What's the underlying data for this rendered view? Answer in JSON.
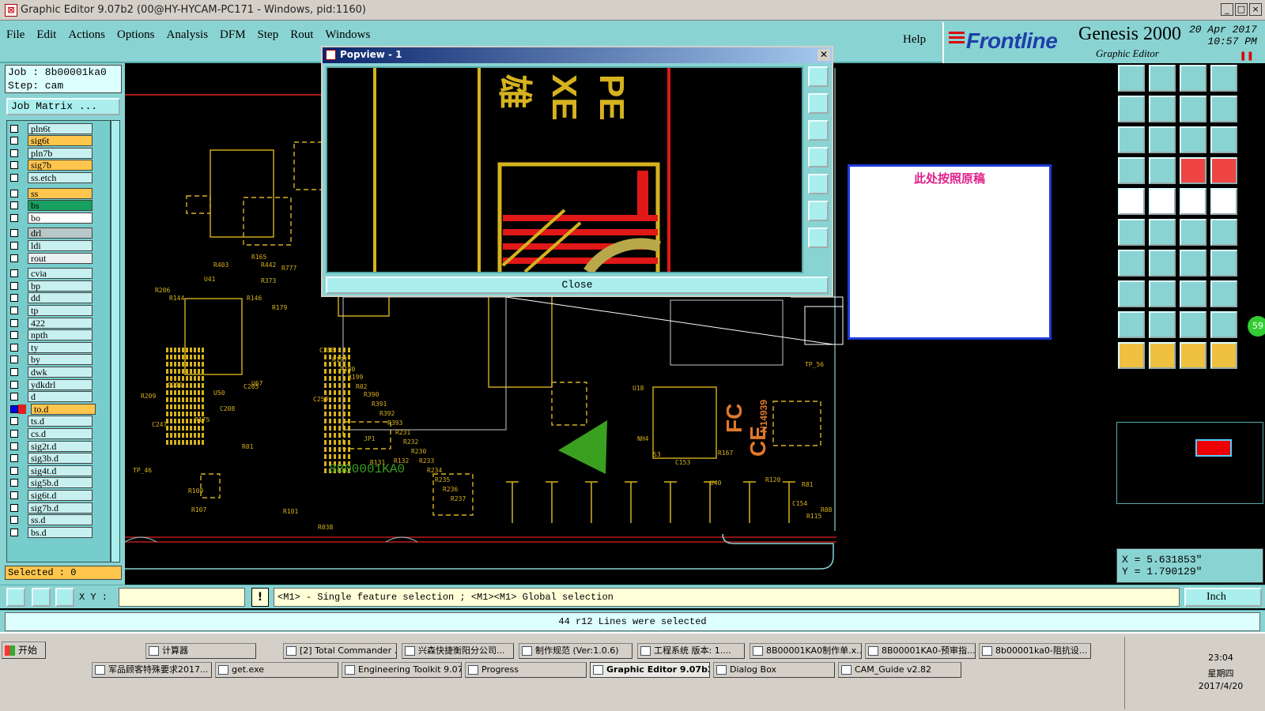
{
  "window": {
    "title": "Graphic Editor 9.07b2 (00@HY-HYCAM-PC171 - Windows, pid:1160)",
    "buttons": [
      "_",
      "□",
      "×"
    ]
  },
  "menu": {
    "items": [
      "File",
      "Edit",
      "Actions",
      "Options",
      "Analysis",
      "DFM",
      "Step",
      "Rout",
      "Windows"
    ],
    "help": "Help"
  },
  "brand": {
    "frontline": "Frontline",
    "genesis": "Genesis 2000",
    "subtitle": "Graphic Editor",
    "date": "20 Apr 2017",
    "time": "10:57 PM"
  },
  "job": {
    "name": "Job : 8b00001ka0",
    "step": "Step: cam",
    "matrix_button": "Job Matrix ..."
  },
  "layers": [
    {
      "name": "pln6t",
      "color": "#c8f0f0"
    },
    {
      "name": "sig6t",
      "color": "#ffc64d"
    },
    {
      "name": "pln7b",
      "color": "#c8f0f0"
    },
    {
      "name": "sig7b",
      "color": "#ffc64d"
    },
    {
      "name": "ss.etch",
      "color": "#c8f0f0"
    },
    {
      "name": "ss",
      "color": "#ffc64d"
    },
    {
      "name": "bs",
      "color": "#18a060"
    },
    {
      "name": "bo",
      "color": "#ffffff"
    },
    {
      "name": "drl",
      "color": "#b8c8c8"
    },
    {
      "name": "ldi",
      "color": "#c8f0f0"
    },
    {
      "name": "rout",
      "color": "#e8f0f0"
    },
    {
      "name": "cvia",
      "color": "#c8f0f0"
    },
    {
      "name": "bp",
      "color": "#c8f0f0"
    },
    {
      "name": "dd",
      "color": "#c8f0f0"
    },
    {
      "name": "tp",
      "color": "#c8f0f0"
    },
    {
      "name": "422",
      "color": "#c8f0f0"
    },
    {
      "name": "npth",
      "color": "#c8f0f0"
    },
    {
      "name": "ty",
      "color": "#c8f0f0"
    },
    {
      "name": "by",
      "color": "#c8f0f0"
    },
    {
      "name": "dwk",
      "color": "#c8f0f0"
    },
    {
      "name": "ydkdrl",
      "color": "#c8f0f0"
    },
    {
      "name": "d",
      "color": "#c8f0f0"
    },
    {
      "name": "to.d",
      "color": "#ffc64d",
      "active": true
    },
    {
      "name": "ts.d",
      "color": "#c8f0f0"
    },
    {
      "name": "cs.d",
      "color": "#c8f0f0"
    },
    {
      "name": "sig2t.d",
      "color": "#c8f0f0"
    },
    {
      "name": "sig3b.d",
      "color": "#c8f0f0"
    },
    {
      "name": "sig4t.d",
      "color": "#c8f0f0"
    },
    {
      "name": "sig5b.d",
      "color": "#c8f0f0"
    },
    {
      "name": "sig6t.d",
      "color": "#c8f0f0"
    },
    {
      "name": "sig7b.d",
      "color": "#c8f0f0"
    },
    {
      "name": "ss.d",
      "color": "#c8f0f0"
    },
    {
      "name": "bs.d",
      "color": "#c8f0f0"
    }
  ],
  "selected": "Selected : 0",
  "popview": {
    "title": "Popview - 1",
    "close_label": "Close"
  },
  "note": {
    "text": "此处按照原稿"
  },
  "canvas": {
    "part_number": "8B00001KA0",
    "cert_mark": "N14939",
    "labels": [
      "R165",
      "R442",
      "U41",
      "R777",
      "R146",
      "R179",
      "R403",
      "R144",
      "R373",
      "R206",
      "R209",
      "U50",
      "U67",
      "C205",
      "C208",
      "R01",
      "JP1",
      "R132",
      "R131",
      "U18",
      "NH4",
      "S3",
      "C153",
      "R167",
      "R81",
      "TP_56",
      "U40",
      "R120",
      "C154",
      "R115",
      "R08",
      "R038",
      "R109",
      "R107",
      "R101",
      "TP_46",
      "C247",
      "C219",
      "R175",
      "C259",
      "C288",
      "R177",
      "R180",
      "R199",
      "R02",
      "R390",
      "R391",
      "R392",
      "R393",
      "R231",
      "R232",
      "R230",
      "R233",
      "R234",
      "R235",
      "R236",
      "R237"
    ]
  },
  "coords": {
    "x": "X = 5.631853\"",
    "y": "Y = 1.790129\""
  },
  "badge": "59",
  "command": {
    "xy_label": "X Y :",
    "bang": "!",
    "hint": "<M1> - Single feature selection ; <M1><M1> Global selection",
    "units": "Inch"
  },
  "status": "44 r12 Lines were selected",
  "taskbar": {
    "start": "开始",
    "row1": [
      "计算器",
      "[2] Total Commander ...",
      "兴森快捷衡阳分公司...",
      "制作规范 (Ver:1.0.6)",
      "工程系统  版本: 1....",
      "8B00001KA0制作单.x...",
      "8B00001KA0-预审指...",
      "8b00001ka0-阻抗设..."
    ],
    "row2": [
      "军品顾客特殊要求2017...",
      "get.exe",
      "Engineering Toolkit 9.07...",
      "Progress",
      "Graphic Editor 9.07b2 ...",
      "Dialog Box",
      "CAM_Guide v2.82"
    ],
    "active": "Graphic Editor 9.07b2 ...",
    "clock_time": "23:04",
    "clock_day": "星期四",
    "clock_date": "2017/4/20"
  }
}
